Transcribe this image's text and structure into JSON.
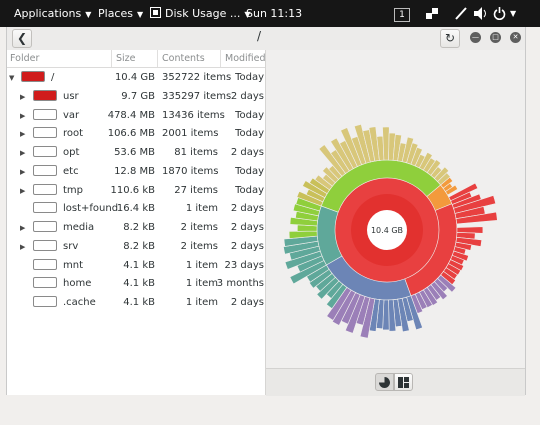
{
  "topbar": {
    "applications": "Applications",
    "places": "Places",
    "app_name": "Disk Usage ...",
    "clock": "Sun 11:13",
    "workspace": "1"
  },
  "header": {
    "path": "/",
    "back_icon": "go-back-icon",
    "refresh_icon": "refresh-icon"
  },
  "columns": {
    "folder": "Folder",
    "size": "Size",
    "contents": "Contents",
    "modified": "Modified"
  },
  "rows": [
    {
      "name": "/",
      "size": "10.4 GB",
      "contents": "352722 items",
      "modified": "Today",
      "expander": "▼",
      "color": "#d01c1c"
    },
    {
      "name": "usr",
      "size": "9.7 GB",
      "contents": "335297 items",
      "modified": "2 days",
      "expander": "▶",
      "color": "#d01c1c"
    },
    {
      "name": "var",
      "size": "478.4 MB",
      "contents": "13436 items",
      "modified": "Today",
      "expander": "▶",
      "color": "#ffffff"
    },
    {
      "name": "root",
      "size": "106.6 MB",
      "contents": "2001 items",
      "modified": "Today",
      "expander": "▶",
      "color": "#ffffff"
    },
    {
      "name": "opt",
      "size": "53.6 MB",
      "contents": "81 items",
      "modified": "2 days",
      "expander": "▶",
      "color": "#ffffff"
    },
    {
      "name": "etc",
      "size": "12.8 MB",
      "contents": "1870 items",
      "modified": "Today",
      "expander": "▶",
      "color": "#ffffff"
    },
    {
      "name": "tmp",
      "size": "110.6 kB",
      "contents": "27 items",
      "modified": "Today",
      "expander": "▶",
      "color": "#ffffff"
    },
    {
      "name": "lost+found",
      "size": "16.4 kB",
      "contents": "1 item",
      "modified": "2 days",
      "expander": "",
      "color": "#ffffff"
    },
    {
      "name": "media",
      "size": "8.2 kB",
      "contents": "2 items",
      "modified": "2 days",
      "expander": "▶",
      "color": "#ffffff"
    },
    {
      "name": "srv",
      "size": "8.2 kB",
      "contents": "2 items",
      "modified": "2 days",
      "expander": "▶",
      "color": "#ffffff"
    },
    {
      "name": "mnt",
      "size": "4.1 kB",
      "contents": "1 item",
      "modified": "23 days",
      "expander": "",
      "color": "#ffffff"
    },
    {
      "name": "home",
      "size": "4.1 kB",
      "contents": "1 item",
      "modified": "3 months",
      "expander": "",
      "color": "#ffffff"
    },
    {
      "name": ".cache",
      "size": "4.1 kB",
      "contents": "1 item",
      "modified": "2 days",
      "expander": "",
      "color": "#ffffff"
    }
  ],
  "chart": {
    "center_label": "10.4 GB",
    "colors": {
      "root": "#e2312f",
      "red_ring": "#e84040",
      "green": "#8fcf3c",
      "olive": "#c9c05a",
      "orange": "#f39a3c",
      "blue": "#6c85b6",
      "purple": "#9b7fb8",
      "teal": "#5fa89a",
      "khaki": "#d8c77a"
    }
  },
  "bottom": {
    "view_rings_icon": "rings-chart-icon",
    "view_treemap_icon": "treemap-chart-icon"
  }
}
